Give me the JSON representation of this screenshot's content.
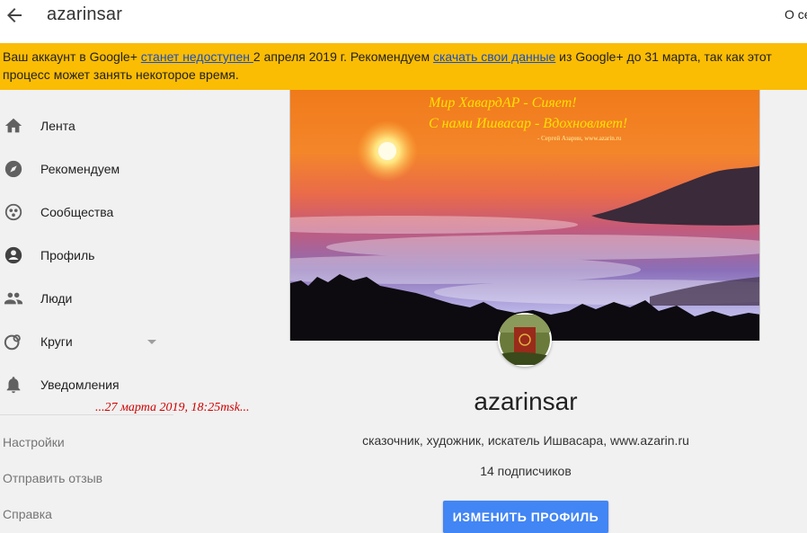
{
  "header": {
    "title": "azarinsar",
    "about_label": "О се"
  },
  "banner": {
    "text_before": "Ваш аккаунт в Google+ ",
    "link1": "станет недоступен ",
    "text_middle": "2 апреля 2019 г. Рекомендуем ",
    "link2": "скачать свои данные",
    "text_after": " из Google+ до 31 марта, так как этот процесс может занять некоторое время.",
    "bg_color": "#fbbc04"
  },
  "sidebar": {
    "items": [
      {
        "label": "Лента",
        "icon": "home-icon"
      },
      {
        "label": "Рекомендуем",
        "icon": "compass-icon"
      },
      {
        "label": "Сообщества",
        "icon": "communities-icon"
      },
      {
        "label": "Профиль",
        "icon": "account-circle-icon"
      },
      {
        "label": "Люди",
        "icon": "people-icon"
      },
      {
        "label": "Круги",
        "icon": "circles-icon"
      },
      {
        "label": "Уведомления",
        "icon": "bell-icon"
      }
    ],
    "links": [
      "Настройки",
      "Отправить отзыв",
      "Справка"
    ]
  },
  "cover": {
    "line1": "Мир ХавардАР - Сияет!",
    "line2": "С нами Ишвасар - Вдохновляет!",
    "credit": "- Сергей Азарин, www.azarin.ru"
  },
  "timestamp": "...27 марта 2019, 18:25msk...",
  "profile": {
    "name": "azarinsar",
    "tagline": "сказочник, художник, искатель Ишвасара, www.azarin.ru",
    "followers": "14 подписчиков",
    "edit_button": "ИЗМЕНИТЬ ПРОФИЛЬ",
    "accent_color": "#4285f4"
  }
}
